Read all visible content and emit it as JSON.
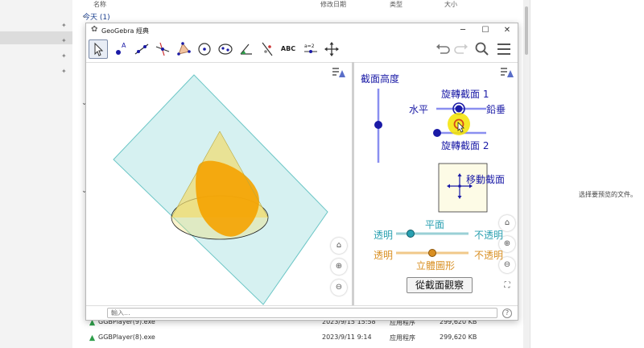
{
  "explorer": {
    "columns": {
      "name": "名称",
      "modified": "修改日期",
      "type": "类型",
      "size": "大小"
    },
    "group_label": "今天 (1)",
    "preview_message": "选择要预览的文件。",
    "files": [
      {
        "name": "GGBPlayer(9).exe",
        "date": "2023/9/15 15:58",
        "type": "应用程序",
        "size": "299,620 KB"
      },
      {
        "name": "GGBPlayer(8).exe",
        "date": "2023/9/11 9:14",
        "type": "应用程序",
        "size": "299,620 KB"
      }
    ]
  },
  "window": {
    "title": "GeoGebra 經典",
    "minimize": "─",
    "maximize": "☐",
    "close": "✕"
  },
  "toolbar": {
    "text_tool": "ABC",
    "slider_tool": "a=2",
    "icons": [
      "move-tool-icon",
      "point-tool-icon",
      "line-tool-icon",
      "perpendicular-tool-icon",
      "polygon-tool-icon",
      "circle-tool-icon",
      "conic-tool-icon",
      "angle-tool-icon",
      "reflect-tool-icon",
      "text-tool-icon",
      "slider-tool-icon",
      "move-view-tool-icon",
      "undo-icon",
      "redo-icon",
      "search-icon",
      "menu-icon"
    ]
  },
  "panel2": {
    "section_height": "截面高度",
    "rotate1": "旋轉截面 1",
    "rotate2": "旋轉截面 2",
    "horizontal": "水平",
    "vertical": "鉛垂",
    "move_section": "移動截面",
    "plane_label": "平面",
    "solid_label": "立體圖形",
    "transparent1": "透明",
    "opaque1": "不透明",
    "transparent2": "透明",
    "opaque2": "不透明",
    "view_button": "從截面觀察"
  },
  "input_bar": {
    "placeholder": "輸入...",
    "help": "?"
  },
  "colors": {
    "plane_fill": "#c8ecec",
    "plane_stroke": "#6cc6c6",
    "cone_fill": "#f1dc6e",
    "section_fill": "#f5a300",
    "blue": "#1a1aa6",
    "teal": "#29a0b1",
    "orange": "#d98f22",
    "slider_blue": "#8a8ff0",
    "highlight": "#f5e400"
  }
}
